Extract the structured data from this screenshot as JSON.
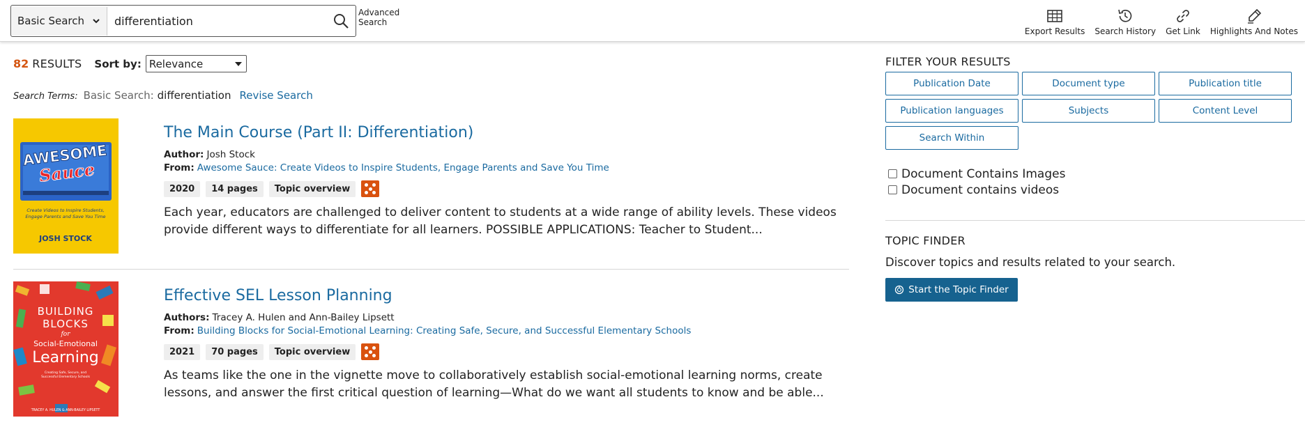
{
  "header": {
    "search_type": "Basic Search",
    "search_value": "differentiation",
    "search_icon": "search-icon",
    "advanced_search": "Advanced Search",
    "tools": [
      {
        "label": "Export Results",
        "icon": "table-icon"
      },
      {
        "label": "Search History",
        "icon": "history-icon"
      },
      {
        "label": "Get Link",
        "icon": "link-icon"
      },
      {
        "label": "Highlights And Notes",
        "icon": "pen-icon"
      }
    ]
  },
  "results": {
    "count": "82",
    "results_word": "RESULTS",
    "sort_label": "Sort by:",
    "sort_value": "Relevance",
    "search_terms_label": "Search Terms:",
    "search_terms_type": "Basic Search:",
    "search_terms_value": "differentiation",
    "revise_label": "Revise Search",
    "items": [
      {
        "title": "The Main Course (Part II: Differentiation)",
        "author_label": "Author:",
        "author": "Josh Stock",
        "from_label": "From:",
        "from": "Awesome Sauce: Create Videos to Inspire Students, Engage Parents and Save You Time",
        "year": "2020",
        "pages": "14 pages",
        "doc_type": "Topic overview",
        "abstract": "Each year, educators are challenged to deliver content to students at a wide range of ability levels. These videos provide different ways to differentiate for all learners. POSSIBLE APPLICATIONS: Teacher to Student...",
        "cover": {
          "title_line1": "AWESOME",
          "title_line2": "Sauce",
          "subtitle": "Create Videos to Inspire Students, Engage Parents and Save You Time",
          "author": "JOSH STOCK"
        }
      },
      {
        "title": "Effective SEL Lesson Planning",
        "author_label": "Authors:",
        "author": "Tracey A. Hulen and Ann-Bailey Lipsett",
        "from_label": "From:",
        "from": "Building Blocks for Social-Emotional Learning: Creating Safe, Secure, and Successful Elementary Schools",
        "year": "2021",
        "pages": "70 pages",
        "doc_type": "Topic overview",
        "abstract": "As teams like the one in the vignette move to collaboratively establish social-emotional learning norms, create lessons, and answer the first critical question of learning—What do we want all students to know and be able...",
        "cover": {
          "line1": "BUILDING",
          "line2": "BLOCKS",
          "line3": "for",
          "line4": "Social-Emotional",
          "line5": "Learning",
          "author": "TRACEY A. HULEN & ANN-BAILEY LIPSETT"
        }
      }
    ]
  },
  "filters": {
    "title": "FILTER YOUR RESULTS",
    "buttons": [
      "Publication Date",
      "Document type",
      "Publication title",
      "Publication languages",
      "Subjects",
      "Content Level",
      "Search Within"
    ],
    "checkboxes": [
      "Document Contains Images",
      "Document contains videos"
    ]
  },
  "topic_finder": {
    "title": "TOPIC FINDER",
    "description": "Discover topics and results related to your search.",
    "button": "Start the Topic Finder"
  },
  "colors": {
    "link": "#1a6aa0",
    "accent_orange": "#d45511",
    "primary_button": "#16628f"
  }
}
